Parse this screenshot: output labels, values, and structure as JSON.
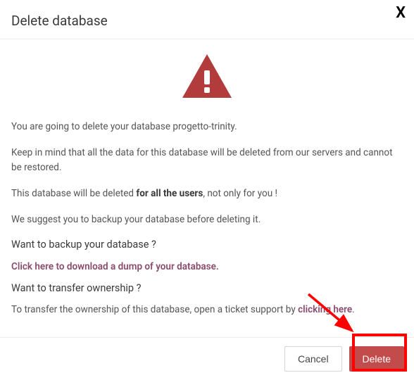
{
  "header": {
    "title": "Delete database",
    "close": "X"
  },
  "body": {
    "line1_pre": "You are going to delete your database ",
    "db_name": "progetto-trinity",
    "line1_post": ".",
    "line2": "Keep in mind that all the data for this database will be deleted from our servers and cannot be restored.",
    "line3_pre": "This database will be deleted ",
    "line3_bold": "for all the users",
    "line3_post": ", not only for you !",
    "line4": "We suggest you to backup your database before deleting it.",
    "heading_backup": "Want to backup your database ?",
    "download_link": "Click here to download a dump of your database.",
    "heading_transfer": "Want to transfer ownership ?",
    "line_transfer_pre": "To transfer the ownership of this database, open a ticket support by ",
    "line_transfer_link": "clicking here",
    "line_transfer_post": "."
  },
  "footer": {
    "cancel": "Cancel",
    "delete": "Delete"
  }
}
